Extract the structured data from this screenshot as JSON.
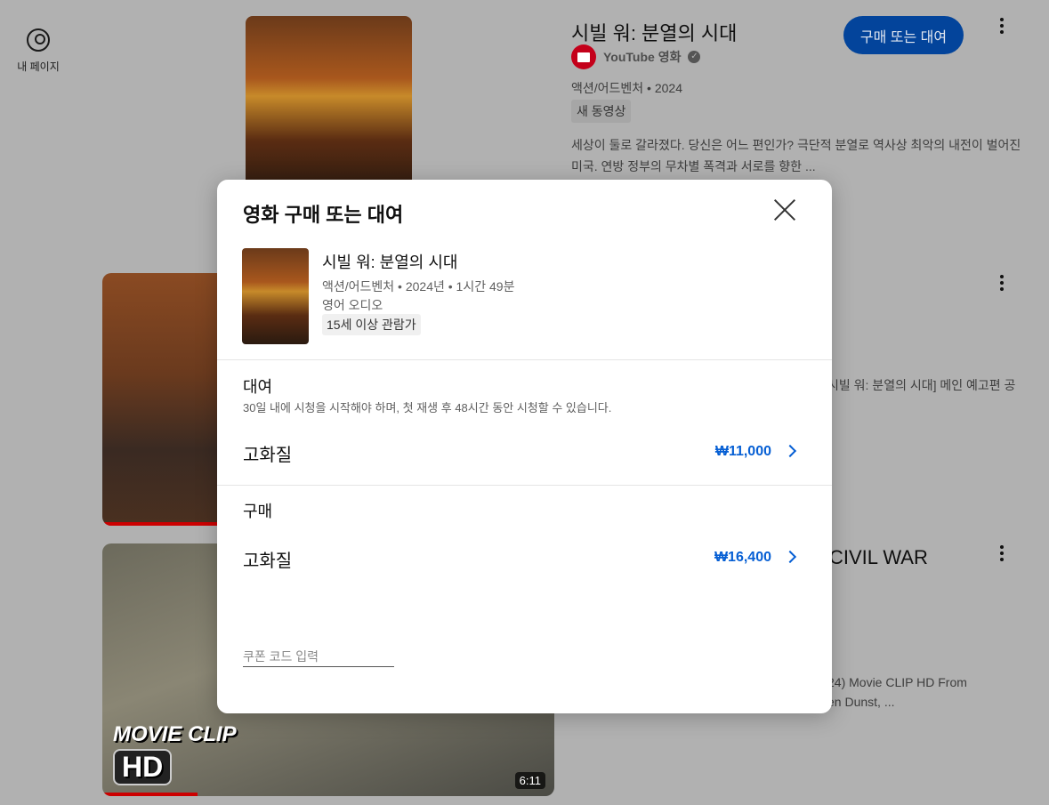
{
  "nav": {
    "my_page_label": "내 페이지"
  },
  "result1": {
    "title": "시빌 워: 분열의 시대",
    "channel": "YouTube 영화",
    "meta": "액션/어드벤처 • 2024",
    "badge": "새 동영상",
    "description": "세상이 둘로 갈라졌다. 당신은 어느 편인가? 극단적 분열로 역사상 최악의 내전이 벌어진 미국. 연방 정부의 무차별 폭격과 서로를 향한 ...",
    "buy_button": "구매 또는 대여"
  },
  "result2": {
    "description_fragment": "시빌 워: 분열의 시대] 메인 예고편 공"
  },
  "result3": {
    "title_fragment": "CIVIL WAR",
    "description_line1": "24) Movie CLIP HD From",
    "description_line2": "en Dunst, ...",
    "thumb_text": "MOVIE CLIP",
    "thumb_hd": "HD",
    "duration": "6:11"
  },
  "modal": {
    "title": "영화 구매 또는 대여",
    "movie_title": "시빌 워: 분열의 시대",
    "movie_meta": "액션/어드벤처 • 2024년 • 1시간 49분",
    "audio": "영어 오디오",
    "rating": "15세 이상 관람가",
    "rent": {
      "heading": "대여",
      "note": "30일 내에 시청을 시작해야 하며, 첫 재생 후 48시간 동안 시청할 수 있습니다.",
      "option_label": "고화질",
      "price": "₩11,000"
    },
    "buy": {
      "heading": "구매",
      "option_label": "고화질",
      "price": "₩16,400"
    },
    "coupon_placeholder": "쿠폰 코드 입력"
  },
  "colors": {
    "accent": "#065fd4",
    "button": "#03449b",
    "overlay_bg": "#b1b1b1"
  }
}
